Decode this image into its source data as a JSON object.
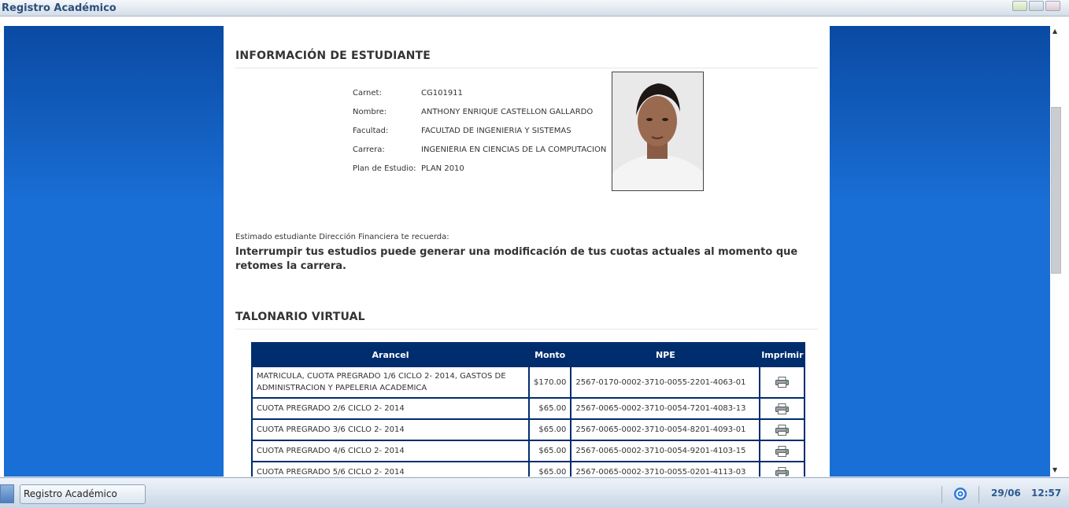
{
  "window": {
    "title": "Registro Académico"
  },
  "student_info": {
    "heading": "INFORMACIÓN DE ESTUDIANTE",
    "fields": [
      {
        "label": "Carnet:",
        "value": "CG101911"
      },
      {
        "label": "Nombre:",
        "value": "ANTHONY ENRIQUE CASTELLON GALLARDO"
      },
      {
        "label": "Facultad:",
        "value": "FACULTAD DE INGENIERIA Y SISTEMAS"
      },
      {
        "label": "Carrera:",
        "value": "INGENIERIA EN CIENCIAS DE LA COMPUTACION"
      },
      {
        "label": "Plan de Estudio:",
        "value": "PLAN 2010"
      }
    ]
  },
  "notice": {
    "small": "Estimado estudiante Dirección Financiera te recuerda:",
    "big": "Interrumpir tus estudios puede generar una modificación de tus cuotas actuales al momento que retomes la carrera."
  },
  "talonario": {
    "heading": "TALONARIO VIRTUAL",
    "columns": [
      "Arancel",
      "Monto",
      "NPE",
      "Imprimir"
    ],
    "rows": [
      {
        "arancel": "MATRICULA, CUOTA PREGRADO 1/6 CICLO 2- 2014, GASTOS DE ADMINISTRACION Y PAPELERIA ACADEMICA",
        "monto": "$170.00",
        "npe": "2567-0170-0002-3710-0055-2201-4063-01"
      },
      {
        "arancel": "CUOTA PREGRADO 2/6 CICLO 2- 2014",
        "monto": "$65.00",
        "npe": "2567-0065-0002-3710-0054-7201-4083-13"
      },
      {
        "arancel": "CUOTA PREGRADO 3/6 CICLO 2- 2014",
        "monto": "$65.00",
        "npe": "2567-0065-0002-3710-0054-8201-4093-01"
      },
      {
        "arancel": "CUOTA PREGRADO 4/6 CICLO 2- 2014",
        "monto": "$65.00",
        "npe": "2567-0065-0002-3710-0054-9201-4103-15"
      },
      {
        "arancel": "CUOTA PREGRADO 5/6 CICLO 2- 2014",
        "monto": "$65.00",
        "npe": "2567-0065-0002-3710-0055-0201-4113-03"
      }
    ]
  },
  "taskbar": {
    "item_label": "Registro Académico",
    "date": "29/06",
    "time": "12:57"
  },
  "colors": {
    "header_blue": "#002d6e",
    "panel_blue": "#1a6fd6",
    "clock_blue": "#2b5a8e"
  },
  "icons": [
    "printer-icon",
    "network-tray-icon",
    "start-icon"
  ]
}
